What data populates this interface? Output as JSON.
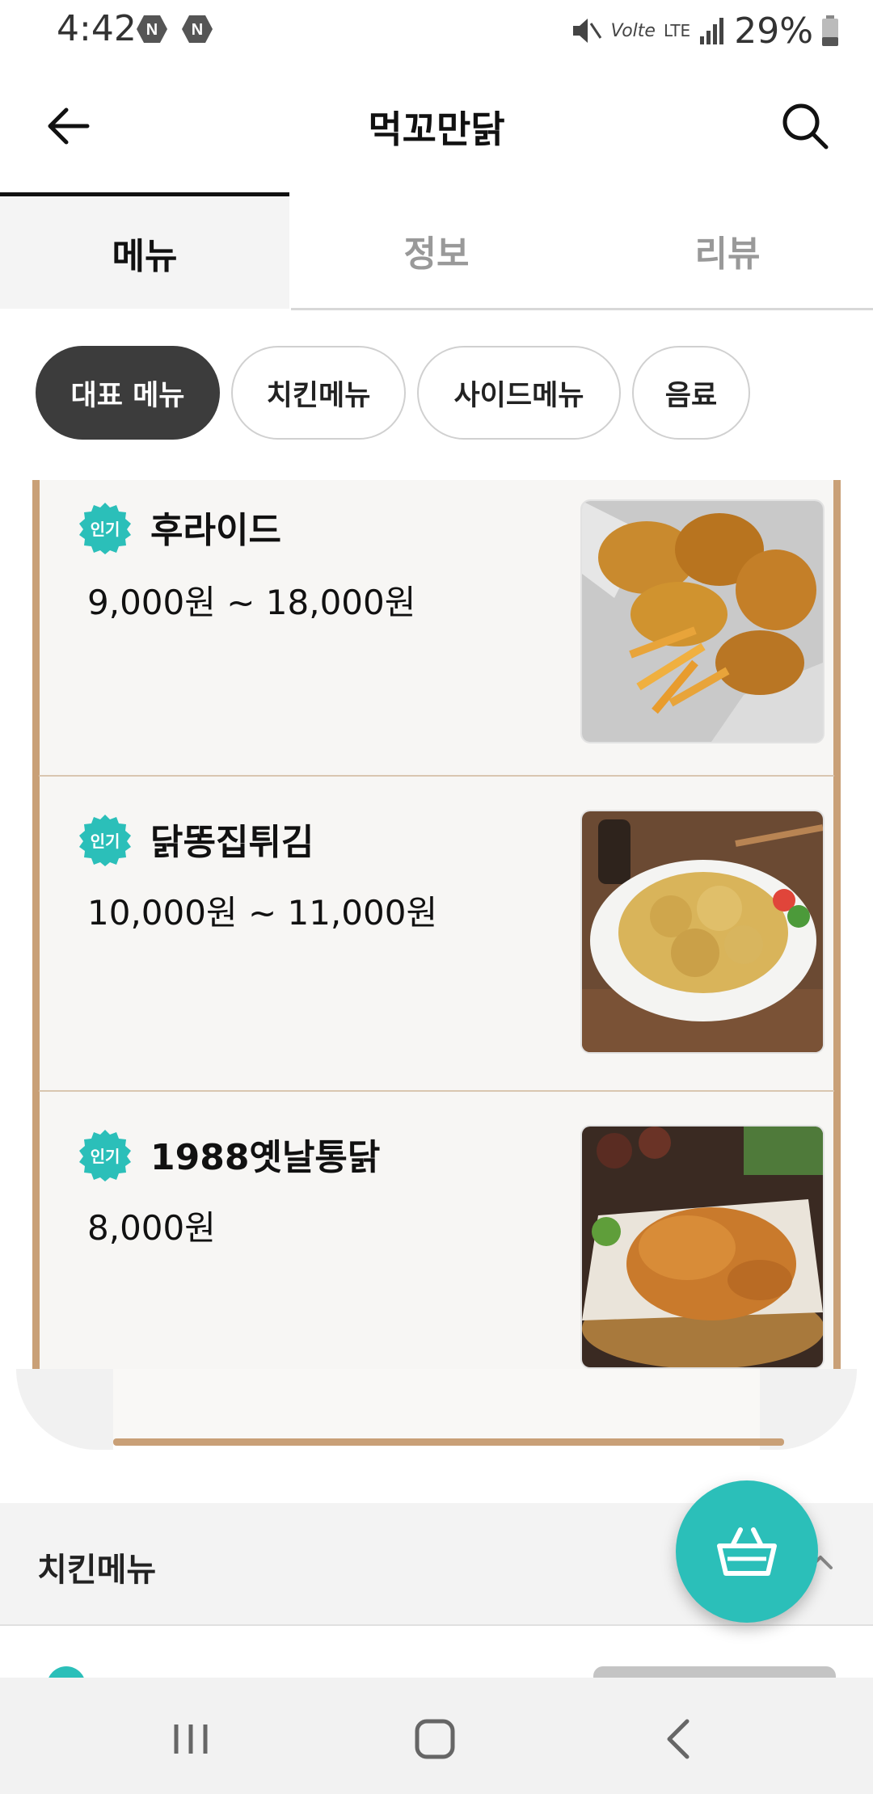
{
  "status_bar": {
    "time": "4:42",
    "notification_badges": [
      "N",
      "N"
    ],
    "network": "Volte",
    "lte": "LTE",
    "battery": "29%"
  },
  "app_bar": {
    "title": "먹꼬만닭",
    "back_icon": "arrow-left-icon",
    "search_icon": "search-icon"
  },
  "tabs": [
    {
      "label": "메뉴",
      "active": true
    },
    {
      "label": "정보",
      "active": false
    },
    {
      "label": "리뷰",
      "active": false
    }
  ],
  "categories": [
    {
      "label": "대표 메뉴",
      "active": true
    },
    {
      "label": "치킨메뉴",
      "active": false
    },
    {
      "label": "사이드메뉴",
      "active": false
    },
    {
      "label": "음료",
      "active": false
    }
  ],
  "featured_items": [
    {
      "badge": "인기",
      "name": "후라이드",
      "price": "9,000원 ~ 18,000원",
      "image": "fried-chicken-with-fries-photo"
    },
    {
      "badge": "인기",
      "name": "닭똥집튀김",
      "price": "10,000원 ~ 11,000원",
      "image": "fried-gizzards-plate-photo"
    },
    {
      "badge": "인기",
      "name": "1988옛날통닭",
      "price": "8,000원",
      "image": "whole-fried-chicken-basket-photo"
    }
  ],
  "section": {
    "title": "치킨메뉴",
    "collapse_icon": "chevron-up-icon"
  },
  "fab": {
    "icon": "shopping-basket-icon",
    "color": "#2bbfb9"
  },
  "colors": {
    "accent": "#2bbfb9",
    "frame": "#c9a077",
    "chip_active": "#3c3c3c"
  }
}
